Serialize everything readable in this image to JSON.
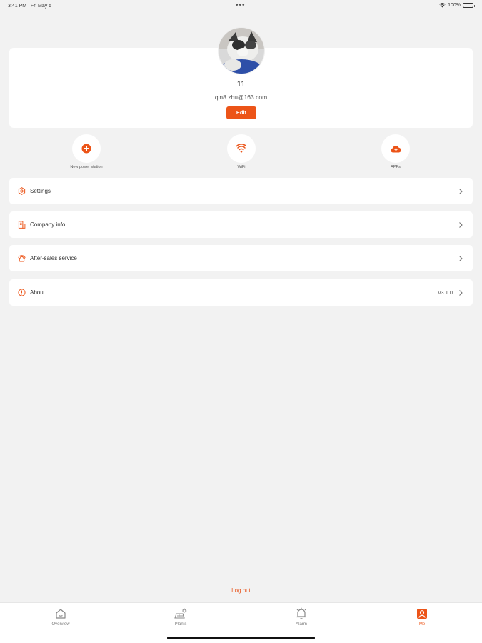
{
  "status_bar": {
    "time": "3:41 PM",
    "date": "Fri May 5",
    "dots": "•••",
    "battery": "100%"
  },
  "profile": {
    "username": "11",
    "email": "qin8.zhu@163.com",
    "edit_label": "Edit"
  },
  "quick_actions": [
    {
      "label": "New power station",
      "icon": "add-circle-icon"
    },
    {
      "label": "WiFi",
      "icon": "wifi-icon"
    },
    {
      "label": "APPs",
      "icon": "cloud-upload-icon"
    }
  ],
  "menu": [
    {
      "label": "Settings",
      "icon": "gear-icon",
      "value": ""
    },
    {
      "label": "Company info",
      "icon": "building-icon",
      "value": ""
    },
    {
      "label": "After-sales service",
      "icon": "phone-service-icon",
      "value": ""
    },
    {
      "label": "About",
      "icon": "info-icon",
      "value": "v3.1.0"
    }
  ],
  "logout_label": "Log out",
  "tabs": [
    {
      "label": "Overview",
      "icon": "home-icon",
      "active": false
    },
    {
      "label": "Plants",
      "icon": "plant-icon",
      "active": false
    },
    {
      "label": "Alarm",
      "icon": "alarm-icon",
      "active": false
    },
    {
      "label": "Me",
      "icon": "person-icon",
      "active": true
    }
  ],
  "colors": {
    "accent": "#ec5418",
    "background": "#f2f2f2",
    "card": "#ffffff"
  }
}
